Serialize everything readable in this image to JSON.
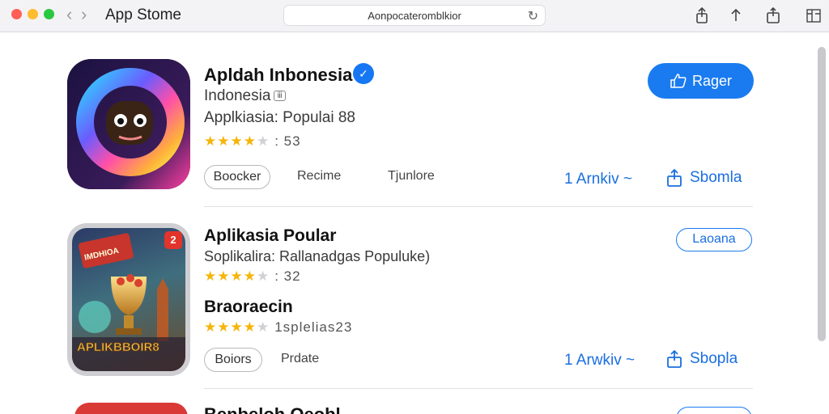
{
  "window": {
    "title": "App Stome",
    "address": "Aonpocateromblkior"
  },
  "apps": [
    {
      "name": "Apldah Inbonesia",
      "developer": "Indonesia",
      "developer_tag": "ⅲ",
      "category": "Applkiasia: Populai 88",
      "rating_stars": 4.5,
      "rating_text": ": 53",
      "get_label": "Rager",
      "pill_label": "Boocker",
      "link_1": "Recime",
      "link_2": "Tjunlore",
      "more_link": "1 Arnkiv ~",
      "share_label": "Sbomla"
    },
    {
      "name": "Aplikasia Poular",
      "subtitle": "Soplikalira: Rallanadgas Populuke)",
      "rating_stars": 4.5,
      "rating_text": ": 32",
      "section_title": "Braoraecin",
      "section_stars": 4.5,
      "section_rating_text": "1splelias23",
      "open_label": "Laoana",
      "pill_label": "Boiors",
      "link_1": "Prdate",
      "more_link": "1 Arwkiv ~",
      "share_label": "Sbopla",
      "icon_badge": "2",
      "icon_text": "APLIKBBOIR8"
    },
    {
      "name": "Benbeloh Oeobl..."
    }
  ],
  "colors": {
    "accent": "#1a7bf0",
    "star": "#f5b50a",
    "titlebar": "#f3f3f5"
  }
}
